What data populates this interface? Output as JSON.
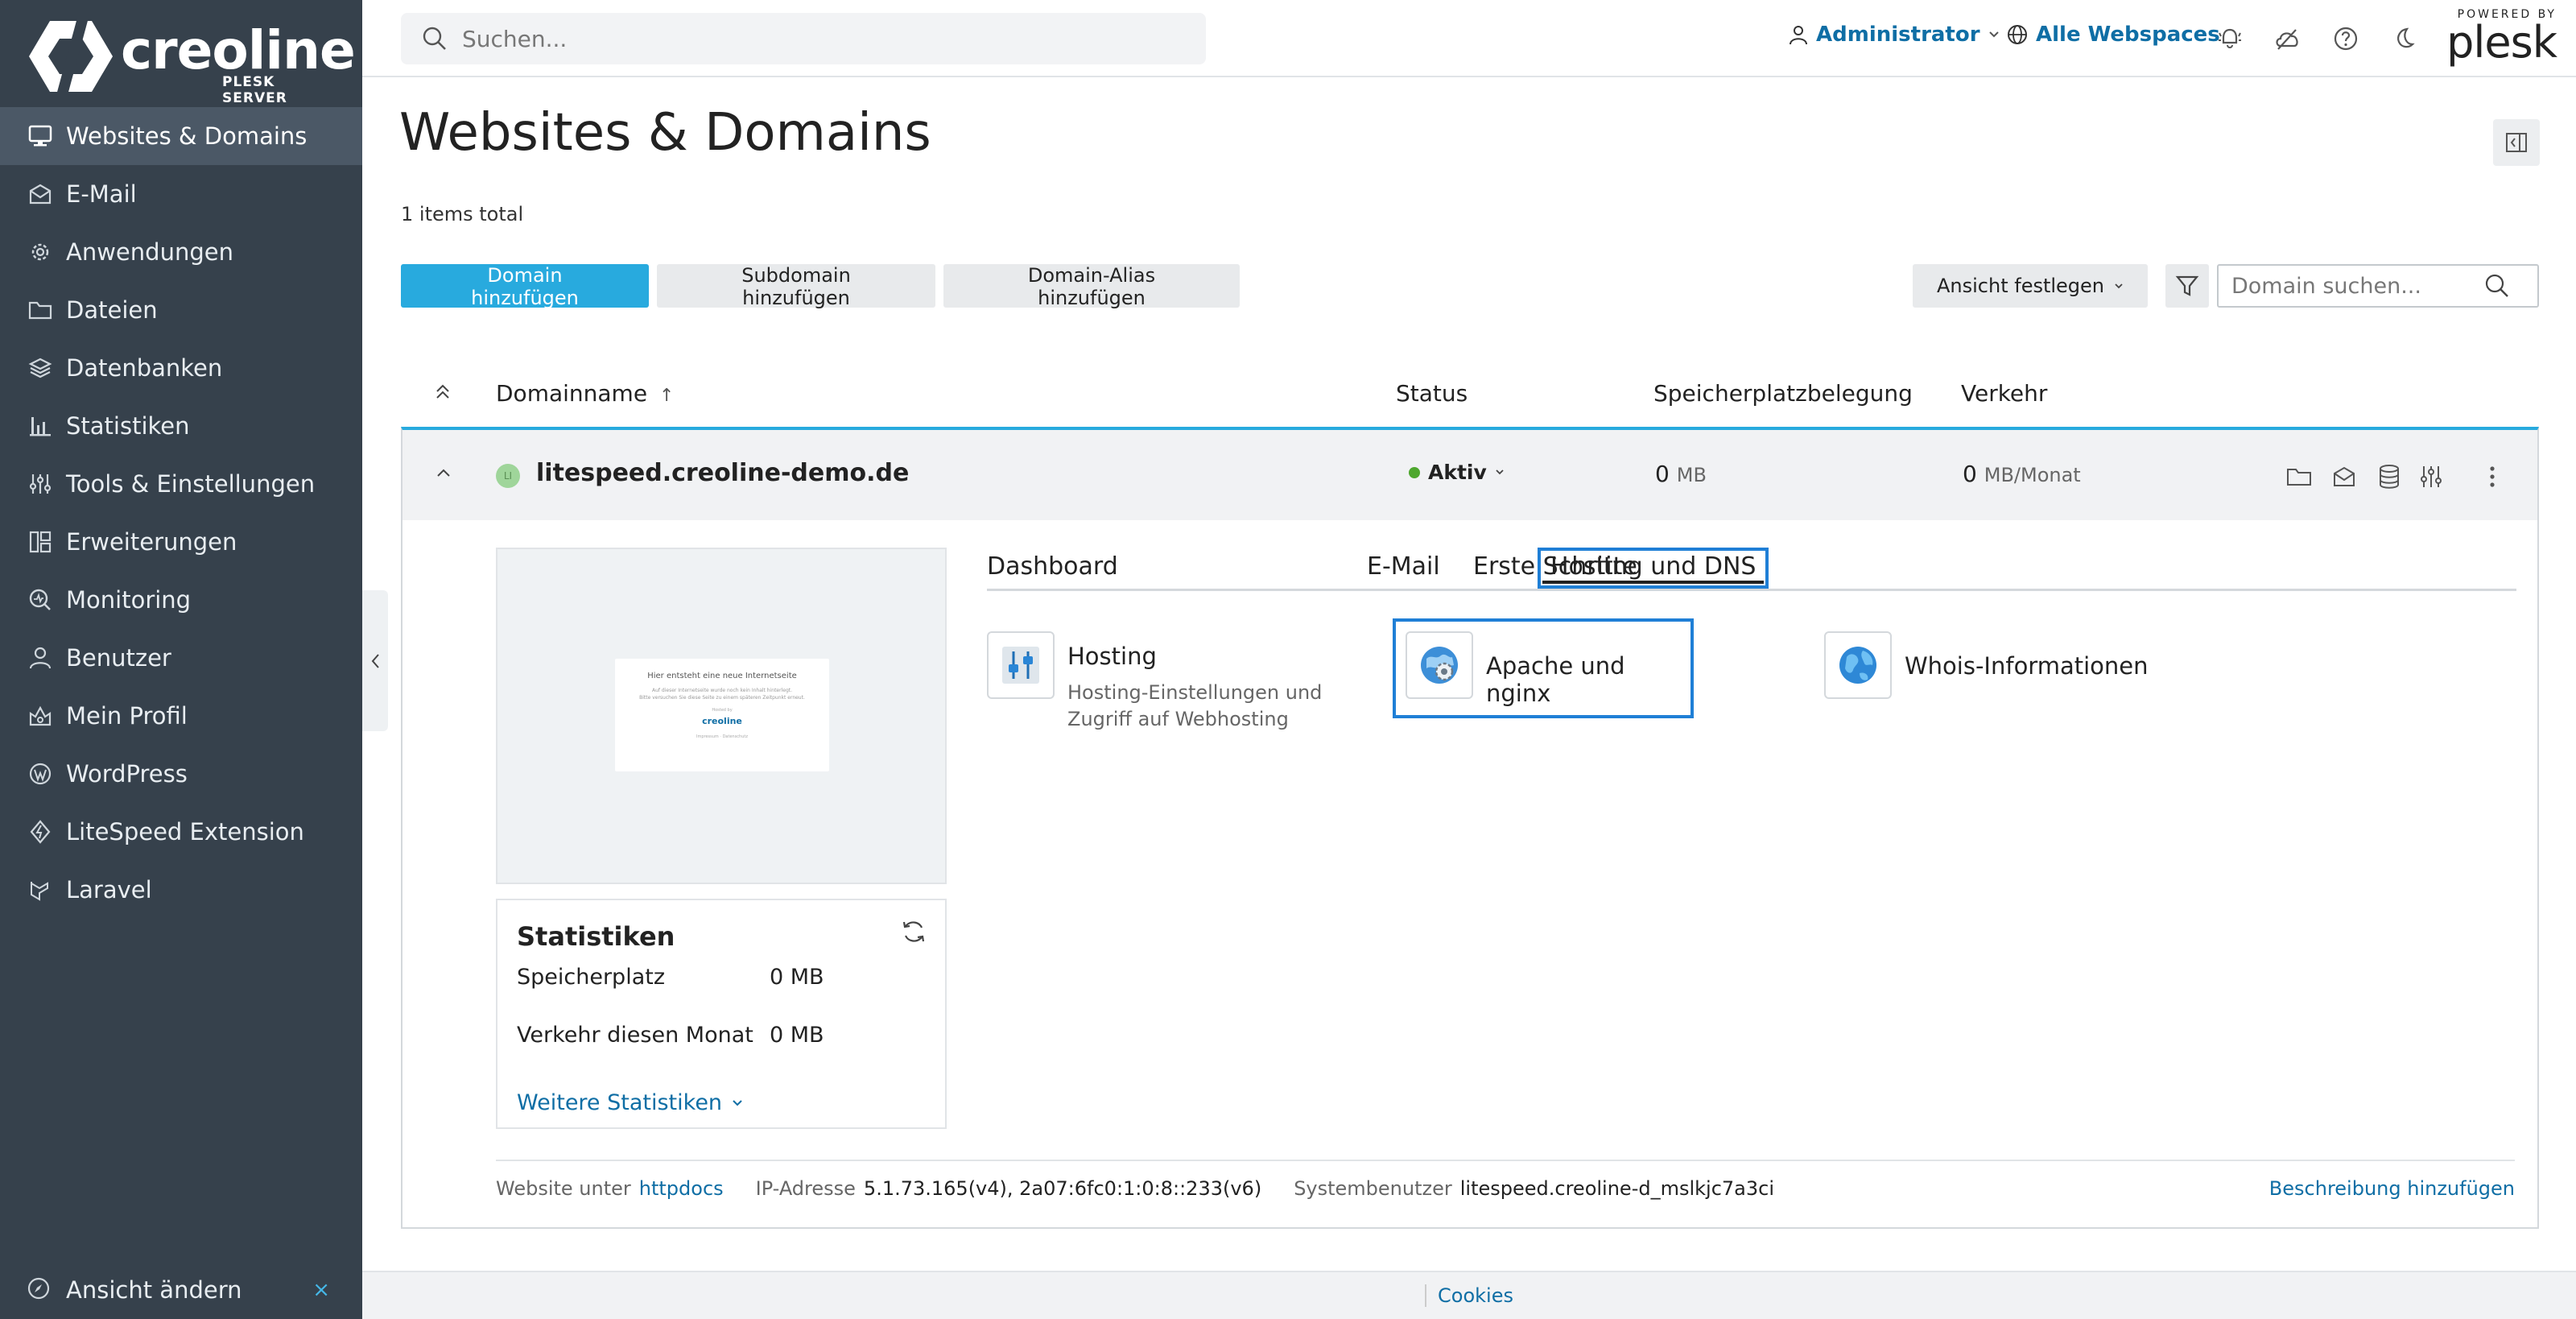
{
  "brand": {
    "name": "creoline",
    "subtitle": "PLESK SERVER"
  },
  "sidebar": {
    "items": [
      {
        "label": "Websites & Domains",
        "icon": "monitor-icon",
        "active": true
      },
      {
        "label": "E-Mail",
        "icon": "mail-icon"
      },
      {
        "label": "Anwendungen",
        "icon": "gear-icon"
      },
      {
        "label": "Dateien",
        "icon": "folder-icon"
      },
      {
        "label": "Datenbanken",
        "icon": "database-icon"
      },
      {
        "label": "Statistiken",
        "icon": "bar-chart-icon"
      },
      {
        "label": "Tools & Einstellungen",
        "icon": "sliders-icon"
      },
      {
        "label": "Erweiterungen",
        "icon": "extensions-icon"
      },
      {
        "label": "Monitoring",
        "icon": "monitoring-icon"
      },
      {
        "label": "Benutzer",
        "icon": "user-icon"
      },
      {
        "label": "Mein Profil",
        "icon": "profile-icon"
      },
      {
        "label": "WordPress",
        "icon": "wordpress-icon"
      },
      {
        "label": "LiteSpeed Extension",
        "icon": "litespeed-icon"
      },
      {
        "label": "Laravel",
        "icon": "laravel-icon"
      }
    ],
    "footer_label": "Ansicht ändern",
    "footer_close": "×"
  },
  "header": {
    "search_placeholder": "Suchen...",
    "user_label": "Administrator",
    "webspaces_label": "Alle Webspaces",
    "powered_by": "POWERED BY",
    "plesk": "plesk"
  },
  "main": {
    "title": "Websites & Domains",
    "items_total": "1 items total",
    "buttons": {
      "add_domain": "Domain hinzufügen",
      "add_subdomain": "Subdomain hinzufügen",
      "add_alias": "Domain-Alias hinzufügen",
      "view": "Ansicht festlegen"
    },
    "domain_search_placeholder": "Domain suchen...",
    "columns": {
      "name": "Domainname",
      "sort_indicator": "↑",
      "status": "Status",
      "storage": "Speicherplatzbelegung",
      "traffic": "Verkehr"
    }
  },
  "domain": {
    "favicon_text": "LI",
    "name": "litespeed.creoline-demo.de",
    "status": "Aktiv",
    "storage_value": "0",
    "storage_unit": "MB",
    "traffic_value": "0",
    "traffic_unit": "MB/Monat",
    "preview": {
      "heading": "Hier entsteht eine neue Internetseite",
      "line1": "Auf dieser Internetseite wurde noch kein Inhalt hinterlegt.",
      "line2": "Bitte versuchen Sie diese Seite zu einem späteren Zeitpunkt erneut.",
      "hosted_by": "Hosted by",
      "brand": "creoline",
      "footer": "Impressum · Datenschutz"
    },
    "stats": {
      "title": "Statistiken",
      "storage_label": "Speicherplatz",
      "storage_value": "0 MB",
      "traffic_label": "Verkehr diesen Monat",
      "traffic_value": "0 MB",
      "more_label": "Weitere Statistiken"
    },
    "tabs": [
      {
        "label": "Dashboard"
      },
      {
        "label": "Hosting und DNS",
        "active": true
      },
      {
        "label": "E-Mail"
      },
      {
        "label": "Erste Schritte"
      }
    ],
    "tiles": {
      "hosting_label": "Hosting",
      "hosting_desc": "Hosting-Einstellungen und Zugriff auf Webhosting",
      "apache_label": "Apache und nginx",
      "whois_label": "Whois-Informationen"
    },
    "info": {
      "website_label": "Website unter",
      "website_link": "httpdocs",
      "ip_label": "IP-Adresse",
      "ip_value": "5.1.73.165(v4), 2a07:6fc0:1:0:8::233(v6)",
      "sysuser_label": "Systembenutzer",
      "sysuser_value": "litespeed.creoline-d_mslkjc7a3ci",
      "add_description": "Beschreibung hinzufügen"
    }
  },
  "footer": {
    "cookies": "Cookies"
  },
  "colors": {
    "sidebar": "#36414c",
    "accent": "#28aade",
    "link": "#0f6ea5",
    "status_active": "#4ea72e"
  }
}
